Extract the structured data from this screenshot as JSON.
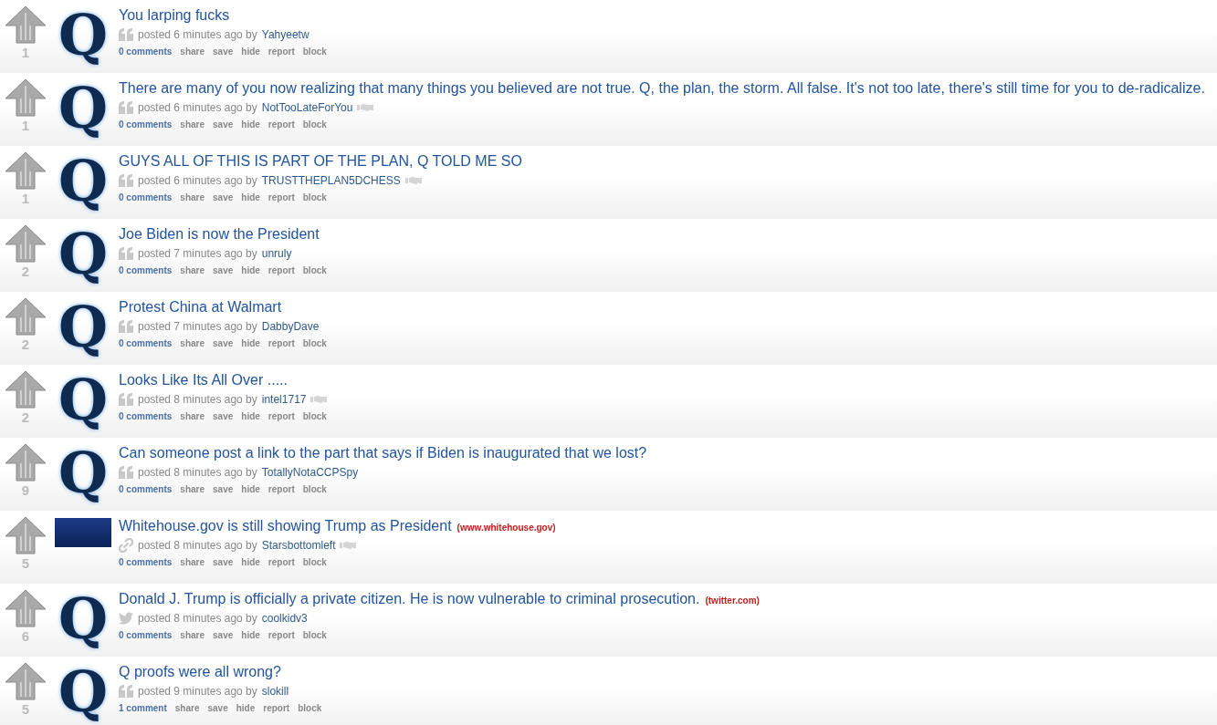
{
  "posts": [
    {
      "score": "1",
      "thumbnail": {
        "kind": "letter",
        "text": "Q"
      },
      "title": "You larping fucks",
      "kind": "text",
      "posted": "posted 6 minutes ago by",
      "author": "Yahyeetw",
      "flair": false,
      "comments": "0 comments",
      "actions": [
        "share",
        "save",
        "hide",
        "report",
        "block"
      ]
    },
    {
      "score": "1",
      "thumbnail": {
        "kind": "letter",
        "text": "Q"
      },
      "title": "There are many of you now realizing that many things you believed are not true. Q, the plan, the storm. All false. It's not too late, there's still time for you to de-radicalize.",
      "kind": "text",
      "posted": "posted 6 minutes ago by",
      "author": "NotTooLateForYou",
      "flair": true,
      "comments": "0 comments",
      "actions": [
        "share",
        "save",
        "hide",
        "report",
        "block"
      ]
    },
    {
      "score": "1",
      "thumbnail": {
        "kind": "letter",
        "text": "Q"
      },
      "title": "GUYS ALL OF THIS IS PART OF THE PLAN, Q TOLD ME SO",
      "kind": "text",
      "posted": "posted 6 minutes ago by",
      "author": "TRUSTTHEPLAN5DCHESS",
      "flair": true,
      "comments": "0 comments",
      "actions": [
        "share",
        "save",
        "hide",
        "report",
        "block"
      ]
    },
    {
      "score": "2",
      "thumbnail": {
        "kind": "letter",
        "text": "Q"
      },
      "title": "Joe Biden is now the President",
      "kind": "text",
      "posted": "posted 7 minutes ago by",
      "author": "unruly",
      "flair": false,
      "comments": "0 comments",
      "actions": [
        "share",
        "save",
        "hide",
        "report",
        "block"
      ]
    },
    {
      "score": "2",
      "thumbnail": {
        "kind": "letter",
        "text": "Q"
      },
      "title": "Protest China at Walmart",
      "kind": "text",
      "posted": "posted 7 minutes ago by",
      "author": "DabbyDave",
      "flair": false,
      "comments": "0 comments",
      "actions": [
        "share",
        "save",
        "hide",
        "report",
        "block"
      ]
    },
    {
      "score": "2",
      "thumbnail": {
        "kind": "letter",
        "text": "Q"
      },
      "title": "Looks Like Its All Over .....",
      "kind": "text",
      "posted": "posted 8 minutes ago by",
      "author": "intel1717",
      "flair": true,
      "comments": "0 comments",
      "actions": [
        "share",
        "save",
        "hide",
        "report",
        "block"
      ]
    },
    {
      "score": "9",
      "thumbnail": {
        "kind": "letter",
        "text": "Q"
      },
      "title": "Can someone post a link to the part that says if Biden is inaugurated that we lost?",
      "kind": "text",
      "posted": "posted 8 minutes ago by",
      "author": "TotallyNotaCCPSpy",
      "flair": false,
      "comments": "0 comments",
      "actions": [
        "share",
        "save",
        "hide",
        "report",
        "block"
      ]
    },
    {
      "score": "5",
      "thumbnail": {
        "kind": "image"
      },
      "title": "Whitehouse.gov is still showing Trump as President",
      "domain": "(www.whitehouse.gov)",
      "kind": "link",
      "posted": "posted 8 minutes ago by",
      "author": "Starsbottomleft",
      "flair": true,
      "comments": "0 comments",
      "actions": [
        "share",
        "save",
        "hide",
        "report",
        "block"
      ]
    },
    {
      "score": "6",
      "thumbnail": {
        "kind": "letter",
        "text": "Q"
      },
      "title": "Donald J. Trump is officially a private citizen. He is now vulnerable to criminal prosecution.",
      "domain": "(twitter.com)",
      "kind": "twitter",
      "posted": "posted 8 minutes ago by",
      "author": "coolkidv3",
      "flair": false,
      "comments": "0 comments",
      "actions": [
        "share",
        "save",
        "hide",
        "report",
        "block"
      ]
    },
    {
      "score": "5",
      "thumbnail": {
        "kind": "letter",
        "text": "Q"
      },
      "title": "Q proofs were all wrong?",
      "kind": "text",
      "posted": "posted 9 minutes ago by",
      "author": "slokill",
      "flair": false,
      "comments": "1 comment",
      "actions": [
        "share",
        "save",
        "hide",
        "report",
        "block"
      ]
    }
  ]
}
